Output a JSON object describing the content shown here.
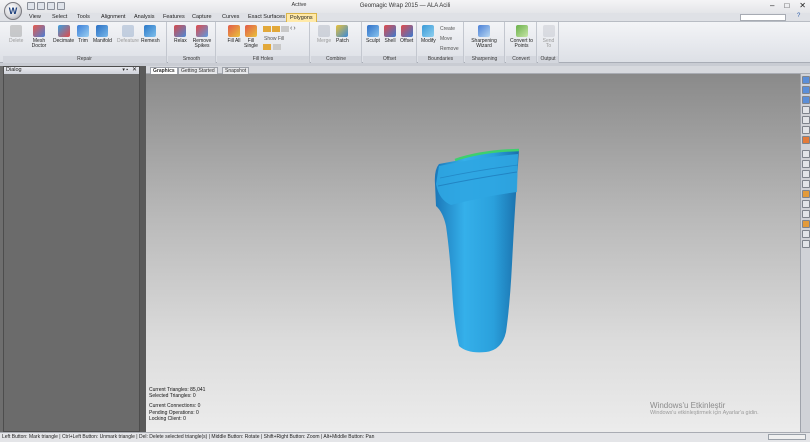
{
  "window": {
    "title": "Geomagic Wrap 2015 — ALA Acili",
    "context_tab_label": "Active",
    "app_orb": "W",
    "controls": {
      "minimize": "–",
      "maximize": "□",
      "close": "✕"
    }
  },
  "tabs": [
    {
      "label": "View",
      "active": false
    },
    {
      "label": "Select",
      "active": false
    },
    {
      "label": "Tools",
      "active": false
    },
    {
      "label": "Alignment",
      "active": false
    },
    {
      "label": "Analysis",
      "active": false
    },
    {
      "label": "Features",
      "active": false
    },
    {
      "label": "Capture",
      "active": false
    },
    {
      "label": "Curves",
      "active": false
    },
    {
      "label": "Exact Surfaces",
      "active": false
    },
    {
      "label": "Polygons",
      "active": true
    }
  ],
  "help_icon": "help-icon",
  "ribbon": {
    "groups": [
      {
        "label": "Repair",
        "buttons": [
          "Delete",
          "Mesh Doctor",
          "Decimate",
          "Trim",
          "Manifold",
          "Defeature",
          "Remesh"
        ]
      },
      {
        "label": "Smooth",
        "buttons": [
          "Relax",
          "Remove Spikes"
        ]
      },
      {
        "label": "Fill Holes",
        "buttons": [
          "Fill All",
          "Fill Single"
        ],
        "small": [
          "Show Fill"
        ]
      },
      {
        "label": "Combine",
        "buttons": [
          "Merge",
          "Patch"
        ]
      },
      {
        "label": "Offset",
        "buttons": [
          "Sculpt",
          "Shell",
          "Offset"
        ]
      },
      {
        "label": "Boundaries",
        "buttons": [
          "Modify"
        ],
        "small": [
          "Create",
          "Move",
          "Remove"
        ]
      },
      {
        "label": "Sharpening",
        "buttons": [
          "Sharpening Wizard"
        ]
      },
      {
        "label": "Convert",
        "buttons": [
          "Convert to Points"
        ]
      },
      {
        "label": "Output",
        "buttons": [
          "Send To"
        ]
      }
    ]
  },
  "dialog_panel": {
    "title": "Dialog",
    "pin": "▾ ▪",
    "close": "✕"
  },
  "viewport_tabs": [
    {
      "label": "Graphics",
      "active": true
    },
    {
      "label": "Getting Started",
      "active": false
    },
    {
      "label": "Snapshot",
      "active": false
    }
  ],
  "stats": {
    "current_triangles": "Current Triangles: 85,041",
    "selected_triangles": "Selected Triangles: 0",
    "current_connections": "Current Connections: 0",
    "pending_operations": "Pending Operations: 0",
    "locking_client": "Locking Client: 0"
  },
  "watermark": {
    "title": "Windows'u Etkinleştir",
    "subtitle": "Windows'u etkinleştirmek için Ayarlar'a gidin."
  },
  "status_bar": {
    "text": "Left Button: Mark triangle | Ctrl+Left Button: Unmark triangle | Del: Delete selected triangle(s) | Middle Button: Rotate | Shift+Right Button: Zoom | Alt+Middle Button: Pan"
  },
  "colors": {
    "model_blue": "#2a9fd8",
    "model_rim": "#3ecf6e",
    "active_tab": "#ffe9a8"
  }
}
